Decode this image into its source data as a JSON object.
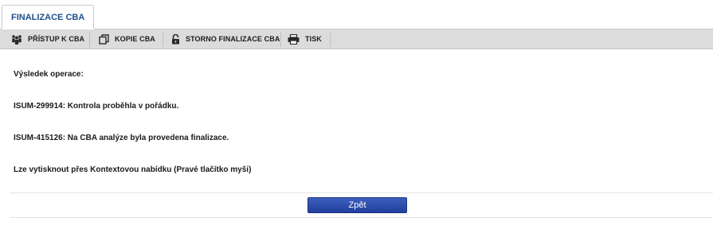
{
  "tab": {
    "label": "FINALIZACE CBA"
  },
  "toolbar": {
    "items": [
      {
        "label": "PŘÍSTUP K CBA",
        "icon": "people-icon"
      },
      {
        "label": "KOPIE CBA",
        "icon": "copy-icon"
      },
      {
        "label": "STORNO FINALIZACE CBA",
        "icon": "unlock-icon"
      },
      {
        "label": "TISK",
        "icon": "printer-icon"
      }
    ]
  },
  "content": {
    "result_heading": "Výsledek operace:",
    "messages": [
      "ISUM-299914: Kontrola proběhla v pořádku.",
      "ISUM-415126: Na CBA analýze byla provedena finalizace.",
      "Lze vytisknout přes Kontextovou nabídku (Pravé tlačítko myši)"
    ]
  },
  "buttons": {
    "back_label": "Zpět"
  },
  "colors": {
    "accent": "#1f4f8c",
    "button": "#2a48a8",
    "toolbar_bg": "#dcdcdc"
  }
}
